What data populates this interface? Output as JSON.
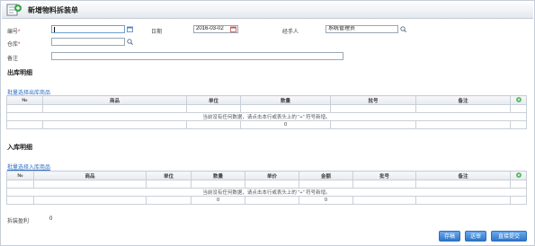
{
  "window": {
    "title": "新增物料拆装单"
  },
  "form": {
    "code": {
      "label": "编号",
      "value": ""
    },
    "date": {
      "label": "日期",
      "value": "2016-03-02"
    },
    "handler": {
      "label": "经手人",
      "value": "系统管理员"
    },
    "warehouse": {
      "label": "仓库",
      "value": ""
    },
    "remark": {
      "label": "备注",
      "value": ""
    }
  },
  "outbound": {
    "title": "出库明细",
    "batch_link": "批量选择出库商品",
    "columns": [
      "№",
      "商品",
      "单位",
      "数量",
      "批号",
      "备注"
    ],
    "empty_message": "当前没有任何数据，请点击本行或表头上的 \"+\" 符号新增。",
    "total_qty": "0"
  },
  "inbound": {
    "title": "入库明细",
    "batch_link": "批量选择入库商品",
    "columns": [
      "№",
      "商品",
      "单位",
      "数量",
      "单价",
      "金额",
      "批号",
      "备注"
    ],
    "empty_message": "当前没有任何数据，请点击本行或表头上的 \"+\" 符号新增。",
    "total_qty": "0",
    "total_amount": "0"
  },
  "footer": {
    "label": "拆装盈利",
    "value": "0"
  },
  "buttons": {
    "save": "存稿",
    "submit_review": "送审",
    "submit_direct": "直接提交"
  },
  "colors": {
    "accent": "#2f77c9",
    "link": "#2a6cc4",
    "required": "#e0201f"
  }
}
